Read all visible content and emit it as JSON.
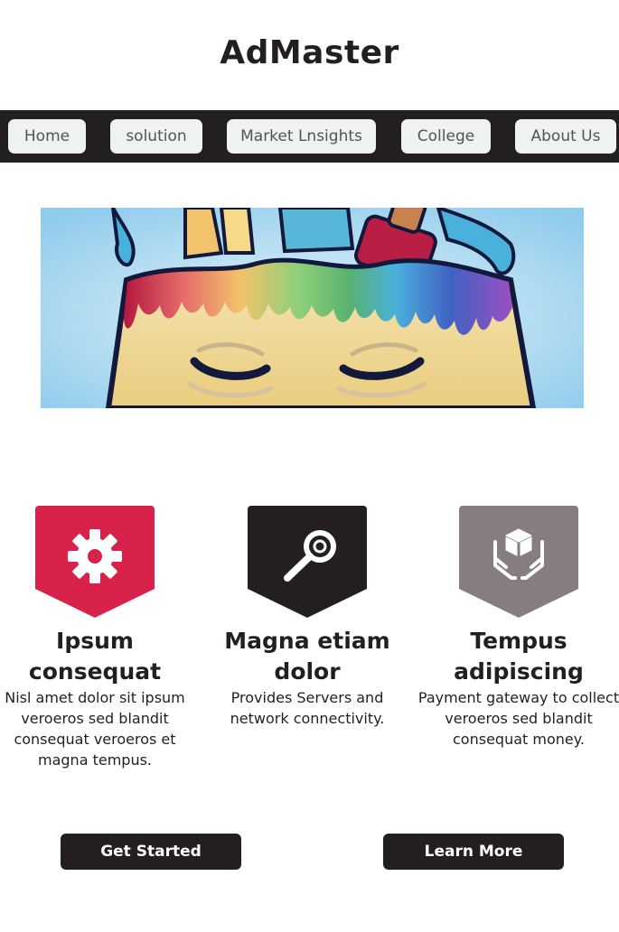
{
  "site": {
    "title": "AdMaster"
  },
  "nav": {
    "items": [
      {
        "label": "Home"
      },
      {
        "label": "solution"
      },
      {
        "label": "Market Lnsights"
      },
      {
        "label": "College"
      },
      {
        "label": "About Us"
      }
    ]
  },
  "banner": {
    "description_icon": "rainbow-paint-head-illustration"
  },
  "features": [
    {
      "title": "Ipsum consequat",
      "text": "Nisl amet dolor sit ipsum veroeros sed blandit consequat veroeros et magna tempus.",
      "icon": "gear-icon",
      "color": "#d8224b"
    },
    {
      "title": "Magna etiam dolor",
      "text": "Provides Servers and network connectivity.",
      "icon": "key-icon",
      "color": "#231f20"
    },
    {
      "title": "Tempus adipiscing",
      "text": "Payment gateway to collect veroeros sed blandit consequat money.",
      "icon": "hands-box-icon",
      "color": "#857d7e"
    }
  ],
  "actions": {
    "get_started": "Get Started",
    "learn_more": "Learn More"
  }
}
